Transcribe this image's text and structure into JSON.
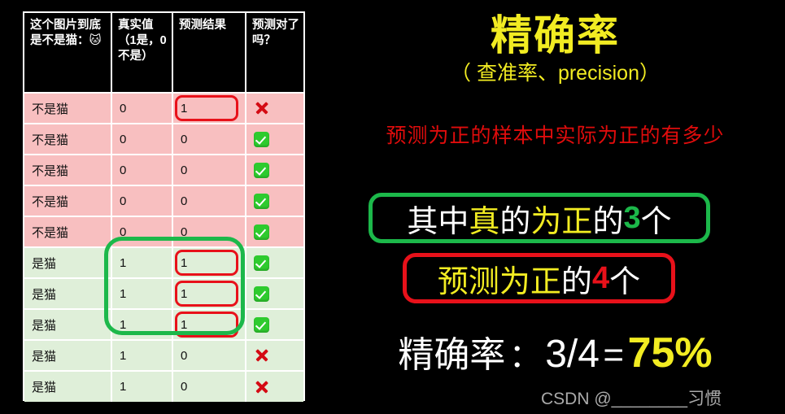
{
  "table": {
    "headers": [
      "这个图片到底是不是猫：🐱",
      "真实值（1是，0不是）",
      "预测结果",
      "预测对了吗？"
    ],
    "rows": [
      {
        "label": "不是猫",
        "truth": "0",
        "pred": "1",
        "correct": "cross-icon",
        "tone": "pink",
        "pred_highlight": true
      },
      {
        "label": "不是猫",
        "truth": "0",
        "pred": "0",
        "correct": "check-icon",
        "tone": "pink",
        "pred_highlight": false
      },
      {
        "label": "不是猫",
        "truth": "0",
        "pred": "0",
        "correct": "check-icon",
        "tone": "pink",
        "pred_highlight": false
      },
      {
        "label": "不是猫",
        "truth": "0",
        "pred": "0",
        "correct": "check-icon",
        "tone": "pink",
        "pred_highlight": false
      },
      {
        "label": "不是猫",
        "truth": "0",
        "pred": "0",
        "correct": "check-icon",
        "tone": "pink",
        "pred_highlight": false
      },
      {
        "label": "是猫",
        "truth": "1",
        "pred": "1",
        "correct": "check-icon",
        "tone": "green",
        "pred_highlight": true
      },
      {
        "label": "是猫",
        "truth": "1",
        "pred": "1",
        "correct": "check-icon",
        "tone": "green",
        "pred_highlight": true
      },
      {
        "label": "是猫",
        "truth": "1",
        "pred": "1",
        "correct": "check-icon",
        "tone": "green",
        "pred_highlight": true
      },
      {
        "label": "是猫",
        "truth": "1",
        "pred": "0",
        "correct": "cross-icon",
        "tone": "green",
        "pred_highlight": false
      },
      {
        "label": "是猫",
        "truth": "1",
        "pred": "0",
        "correct": "cross-icon",
        "tone": "green",
        "pred_highlight": false
      }
    ]
  },
  "right": {
    "title": "精确率",
    "subtitle": "（ 查准率、precision）",
    "description": "预测为正的样本中实际为正的有多少",
    "callout_green": {
      "p1": "其中",
      "p2": "真",
      "p3": "的",
      "p4": "为正",
      "p5": "的",
      "p6": "3",
      "p7": "个"
    },
    "callout_red": {
      "p1": "预测为正",
      "p2": "的",
      "p3": "4",
      "p4": "个"
    },
    "formula": {
      "label": "精确率",
      "colon": "：",
      "fraction": "3/4",
      "equals": "=",
      "percent": "75%"
    },
    "watermark": "CSDN @________习惯"
  },
  "colors": {
    "background": "#000000",
    "row_pink": "#f8bfc0",
    "row_green": "#dfefd9",
    "accent_yellow": "#f2ec22",
    "accent_red": "#e8111a",
    "accent_green": "#1cb84a",
    "text_white": "#ffffff"
  }
}
